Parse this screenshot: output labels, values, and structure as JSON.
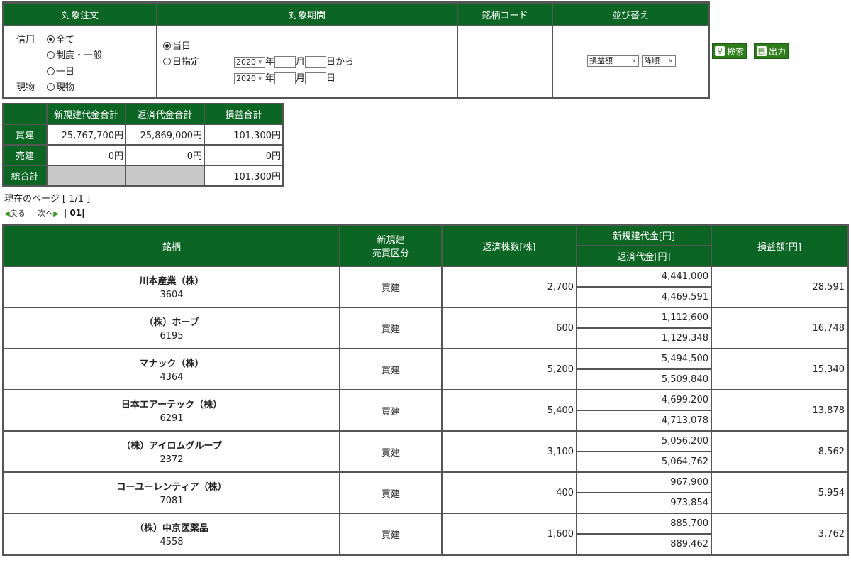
{
  "filter": {
    "headers": [
      "対象注文",
      "対象期間",
      "銘柄コード",
      "並び替え"
    ],
    "order_type": {
      "credit_label": "信用",
      "options": [
        "全て",
        "制度・一般",
        "一日"
      ],
      "cash_label": "現物",
      "cash_option": "現物"
    },
    "period": {
      "today_label": "当日",
      "specify_label": "日指定",
      "year_value": "2020",
      "year_suffix": "年",
      "month_suffix": "月",
      "from_suffix": "日から",
      "day_suffix": "日"
    },
    "sort": {
      "key": "損益額",
      "order": "降順"
    },
    "search_label": "検索",
    "export_label": "出力"
  },
  "summary": {
    "columns": [
      "新規建代金合計",
      "返済代金合計",
      "損益合計"
    ],
    "rows": [
      {
        "label": "買建",
        "values": [
          "25,767,700円",
          "25,869,000円",
          "101,300円"
        ]
      },
      {
        "label": "売建",
        "values": [
          "0円",
          "0円",
          "0円"
        ]
      }
    ],
    "total_label": "総合計",
    "total_value": "101,300円"
  },
  "page_info": "現在のページ [ 1/1 ]",
  "pager": {
    "prev": "戻る",
    "next": "次へ",
    "current": "01"
  },
  "results": {
    "headers": {
      "name": "銘柄",
      "side_line1": "新規建",
      "side_line2": "売買区分",
      "shares": "返済株数[株]",
      "open_amount": "新規建代金[円]",
      "close_amount": "返済代金[円]",
      "pnl": "損益額[円]"
    },
    "rows": [
      {
        "name": "川本産業（株）",
        "code": "3604",
        "side": "買建",
        "shares": "2,700",
        "open": "4,441,000",
        "close": "4,469,591",
        "pnl": "28,591"
      },
      {
        "name": "（株）ホープ",
        "code": "6195",
        "side": "買建",
        "shares": "600",
        "open": "1,112,600",
        "close": "1,129,348",
        "pnl": "16,748"
      },
      {
        "name": "マナック（株）",
        "code": "4364",
        "side": "買建",
        "shares": "5,200",
        "open": "5,494,500",
        "close": "5,509,840",
        "pnl": "15,340"
      },
      {
        "name": "日本エアーテック（株）",
        "code": "6291",
        "side": "買建",
        "shares": "5,400",
        "open": "4,699,200",
        "close": "4,713,078",
        "pnl": "13,878"
      },
      {
        "name": "（株）アイロムグループ",
        "code": "2372",
        "side": "買建",
        "shares": "3,100",
        "open": "5,056,200",
        "close": "5,064,762",
        "pnl": "8,562"
      },
      {
        "name": "コーユーレンティア（株）",
        "code": "7081",
        "side": "買建",
        "shares": "400",
        "open": "967,900",
        "close": "973,854",
        "pnl": "5,954"
      },
      {
        "name": "（株）中京医薬品",
        "code": "4558",
        "side": "買建",
        "shares": "1,600",
        "open": "885,700",
        "close": "889,462",
        "pnl": "3,762"
      }
    ]
  }
}
